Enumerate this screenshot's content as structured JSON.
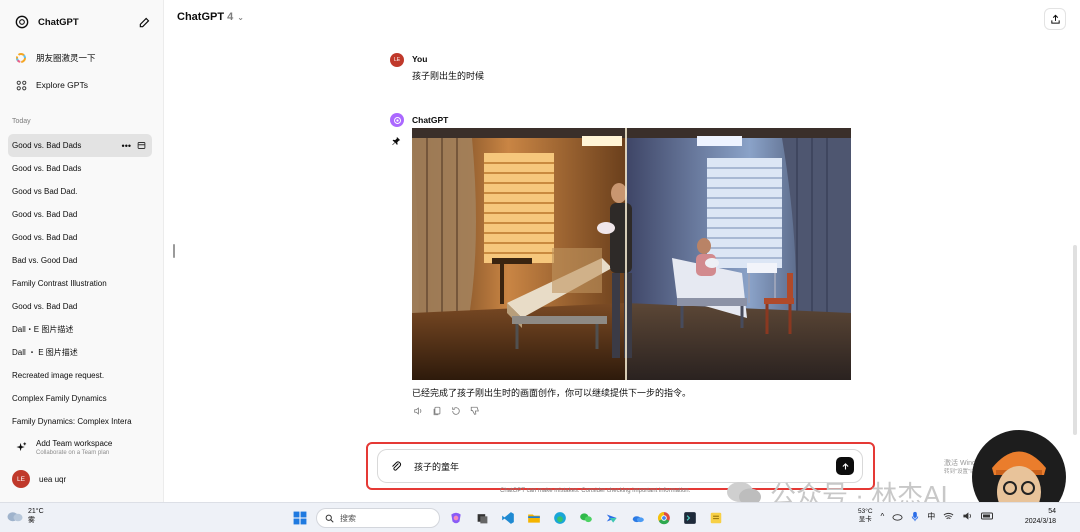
{
  "app": {
    "brand": "ChatGPT"
  },
  "sidebar": {
    "gpts": [
      {
        "label": "朋友圈激灵一下",
        "icon": "color-ring-icon"
      },
      {
        "label": "Explore GPTs",
        "icon": "grid-icon"
      }
    ],
    "section": "Today",
    "chats": [
      "Good vs. Bad Dads",
      "Good vs. Bad Dads",
      "Good vs Bad Dad.",
      "Good vs. Bad Dad",
      "Good vs. Bad Dad",
      "Bad vs. Good Dad",
      "Family Contrast Illustration",
      "Good vs. Bad Dad",
      "Dall・E 图片描述",
      "Dall ・ E 图片描述",
      "Recreated image request.",
      "Complex Family Dynamics",
      "Family Dynamics: Complex Intera"
    ],
    "team": {
      "title": "Add Team workspace",
      "subtitle": "Collaborate on a Team plan"
    },
    "user": {
      "initials": "LE",
      "name": "uea uqr"
    }
  },
  "header": {
    "model": "ChatGPT",
    "version": "4"
  },
  "conversation": {
    "user": {
      "initials": "LE",
      "author": "You",
      "text": "孩子刚出生的时候"
    },
    "assistant": {
      "author": "ChatGPT",
      "text": "已经完成了孩子刚出生时的画面创作，你可以继续提供下一步的指令。"
    }
  },
  "composer": {
    "value": "孩子的童年",
    "disclaimer": "ChatGPT can make mistakes. Consider checking important information."
  },
  "watermark": {
    "activate_line1": "激活 Windows",
    "activate_line2": "转到\"设置\"以激活 Windows。",
    "text": "公众号 · 林杰AI"
  },
  "taskbar": {
    "weather_temp": "21°C",
    "weather_desc": "雾",
    "search_placeholder": "搜索",
    "tray_temp": "53°C",
    "tray_desc": "显卡",
    "ime": "中",
    "time": "54",
    "date": "2024/3/18"
  },
  "colors": {
    "accent_red": "#e53935",
    "avatar_red": "#c0392b",
    "gpt_purple": "#ab68ff"
  }
}
